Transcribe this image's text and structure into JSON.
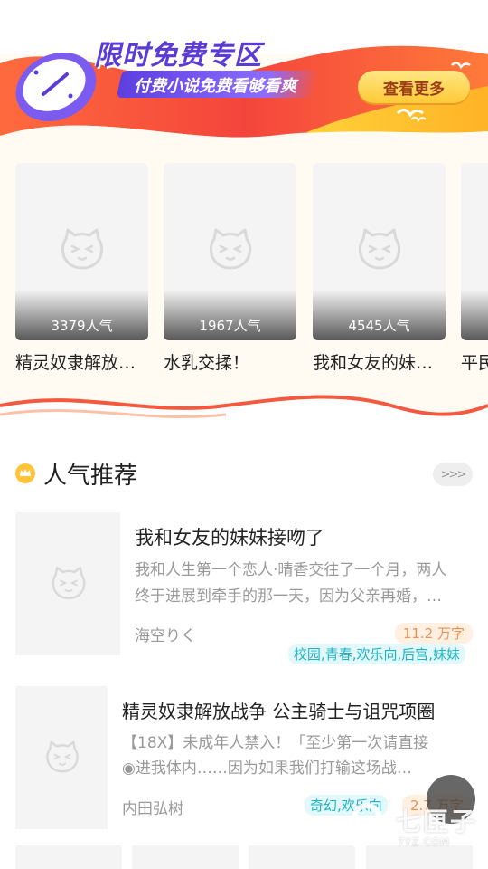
{
  "banner": {
    "title": "限时免费专区",
    "subtitle": "付费小说免费看够看爽",
    "more_button": "查看更多"
  },
  "free_books": [
    {
      "title": "精灵奴隶解放…",
      "popularity": "3379人气"
    },
    {
      "title": "水乳交揉！",
      "popularity": "1967人气"
    },
    {
      "title": "我和女友的妹…",
      "popularity": "4545人气"
    },
    {
      "title": "平民",
      "popularity": ""
    }
  ],
  "popular_section": {
    "title": "人气推荐",
    "more_icon": "triple-chevron-right-icon",
    "header_icon": "crown-icon"
  },
  "books": [
    {
      "title": "我和女友的妹妹接吻了",
      "desc_line1": "我和人生第一个恋人·晴香交往了一个月，两人",
      "desc_line2": "终于进展到牵手的那一天，因为父亲再婚，…",
      "author": "海空りく",
      "words": "11.2 万字",
      "tags": "校园,青春,欢乐向,后宫,妹妹"
    },
    {
      "title": "精灵奴隶解放战争 公主骑士与诅咒项圈",
      "desc_line1": "【18X】未成年人禁入！「至少第一次请直接",
      "desc_line2": "◉进我体内……因为如果我们打输这场战…",
      "author": "内田弘树",
      "words": "2.7 万字",
      "tags": "奇幻,欢乐向"
    }
  ],
  "watermark": {
    "name": "七匣子",
    "domain": "7YZ.COM"
  },
  "colors": {
    "accent_red": "#f4583f",
    "accent_purple": "#5b3bd6",
    "tag_teal": "#1eb3c4",
    "words_orange": "#e8925a"
  }
}
